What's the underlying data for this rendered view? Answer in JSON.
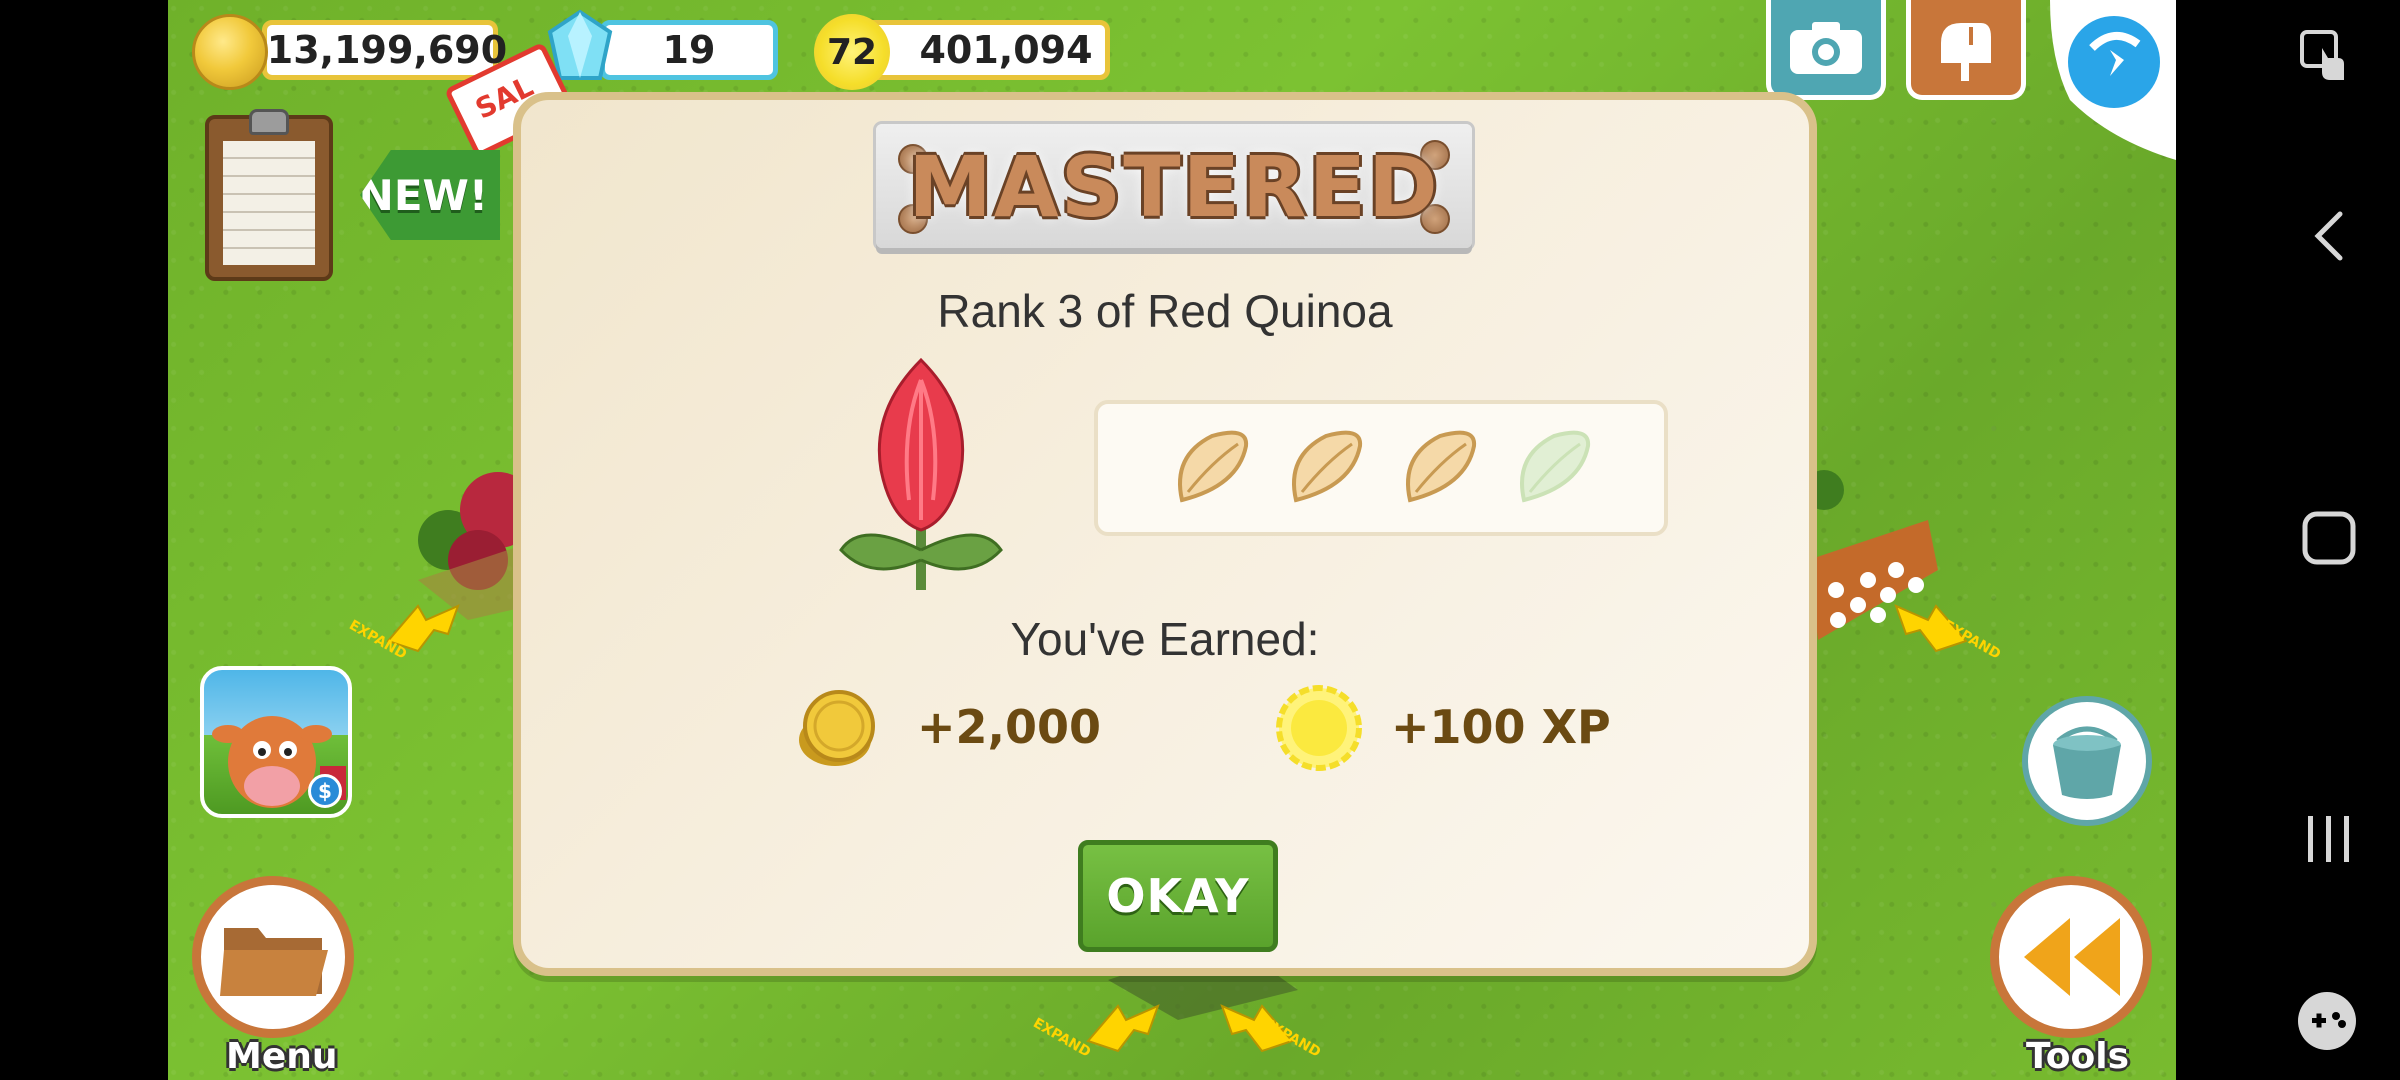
{
  "hud": {
    "coins": "13,199,690",
    "gems": "19",
    "level": "72",
    "xp": "401,094"
  },
  "left_panel": {
    "new_badge": "NEW!",
    "sale_tag": "SAL",
    "menu_label": "Menu"
  },
  "right_panel": {
    "tools_label": "Tools"
  },
  "ground": {
    "expand_label": "EXPAND"
  },
  "modal": {
    "banner": "MASTERED",
    "subtitle": "Rank 3 of Red Quinoa",
    "mastery_rank": 3,
    "mastery_max": 4,
    "earned_label": "You've Earned:",
    "reward_coins": "+2,000",
    "reward_xp": "+100 XP",
    "okay_button": "OKAY"
  },
  "icons": {
    "camera": "camera-icon",
    "mailbox": "mailbox-icon",
    "sync": "sync-icon",
    "bucket": "bucket-icon",
    "folder": "folder-icon",
    "rewind": "rewind-icon"
  },
  "colors": {
    "grass": "#7cc232",
    "gold_border": "#e8c43a",
    "modal_bg": "#f7efdf",
    "okay_green": "#5aa32c",
    "accent_brown": "#c8763a",
    "teal": "#5fa6a8"
  }
}
